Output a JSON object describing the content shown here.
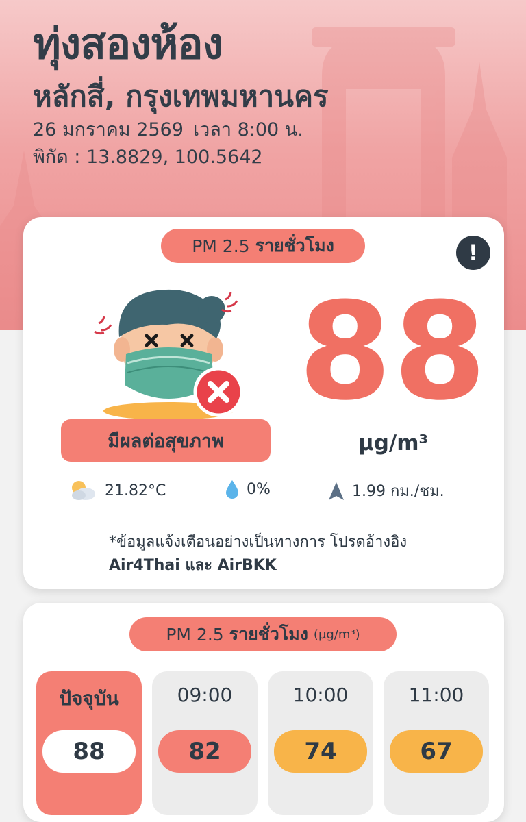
{
  "header": {
    "district": "ทุ่งสองห้อง",
    "subdistrict": "หลักสี่, กรุงเทพมหานคร",
    "date": "26 มกราคม 2569",
    "time": "เวลา 8:00 น.",
    "coords": "พิกัด : 13.8829, 100.5642"
  },
  "current": {
    "title_prefix": "PM 2.5",
    "title_bold": "รายชั่วโมง",
    "info_icon": "!",
    "value": "88",
    "unit": "µg/m³",
    "status_label": "มีผลต่อสุขภาพ",
    "status_color": "#f47f74",
    "weather": {
      "temperature": "21.82°C",
      "rain": "0%",
      "wind": "1.99 กม./ชม."
    },
    "note_line1": "*ข้อมูลแจ้งเตือนอย่างเป็นทางการ โปรดอ้างอิง",
    "note_line2": "Air4Thai และ AirBKK"
  },
  "forecast": {
    "title_prefix": "PM 2.5",
    "title_bold": "รายชั่วโมง",
    "title_unit": "(µg/m³)",
    "slots": [
      {
        "time": "ปัจจุบัน",
        "value": "88",
        "color": "#ffffff"
      },
      {
        "time": "09:00",
        "value": "82",
        "color": "#f47f74"
      },
      {
        "time": "10:00",
        "value": "74",
        "color": "#f8b449"
      },
      {
        "time": "11:00",
        "value": "67",
        "color": "#f8b449"
      }
    ]
  },
  "icons": {
    "info": "info-icon",
    "mascot": "sick-face-mascot",
    "weather": "partly-cloudy-icon",
    "rain": "raindrop-icon",
    "wind": "wind-direction-icon"
  }
}
